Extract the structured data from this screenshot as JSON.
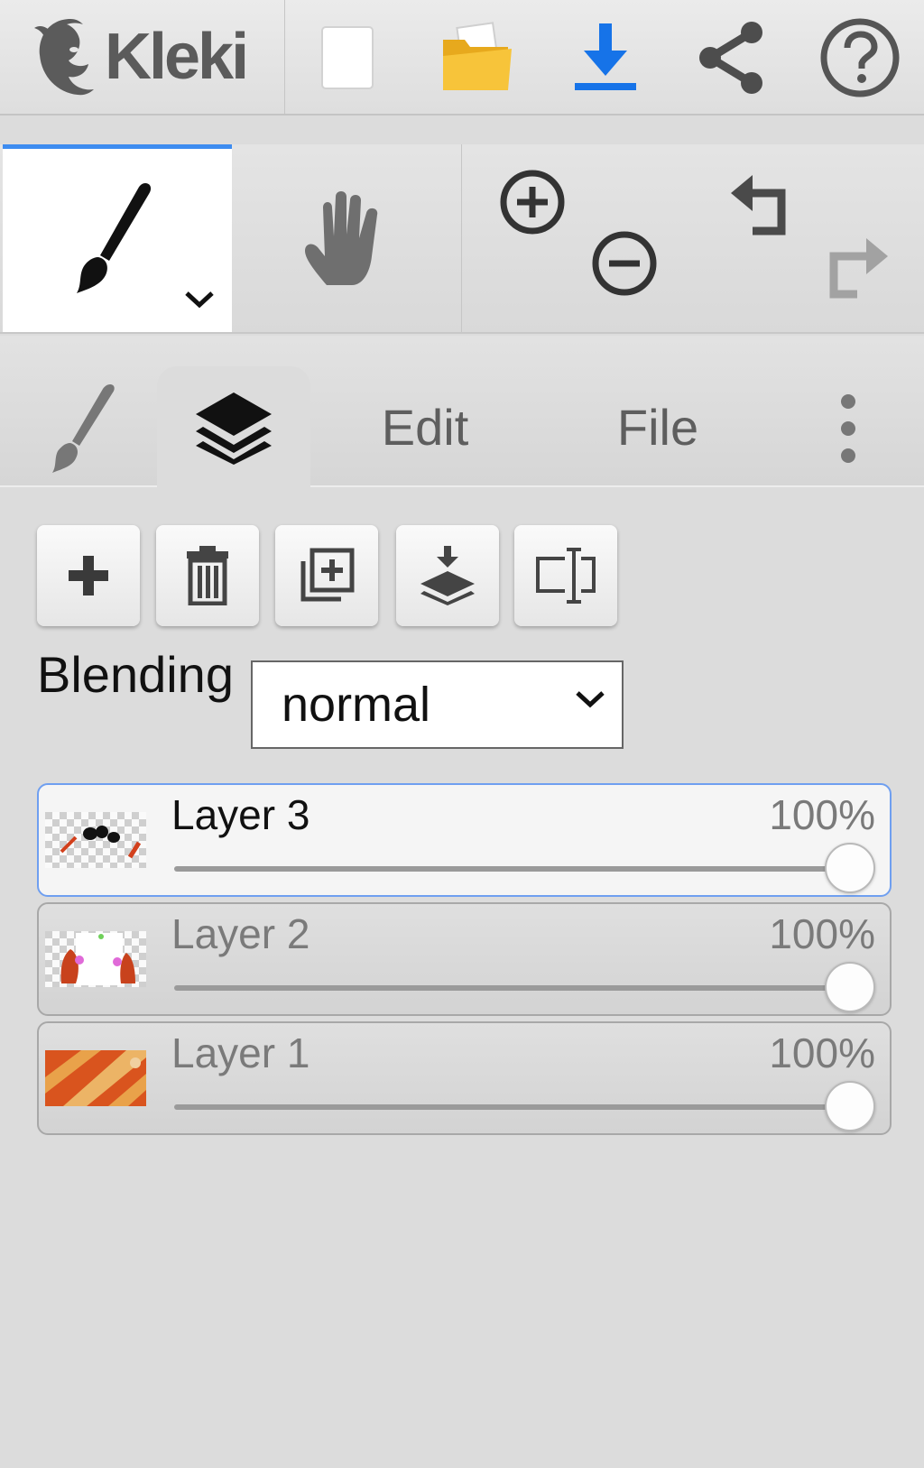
{
  "app": {
    "name": "Kleki"
  },
  "topbar": {
    "icons": [
      "new-image-icon",
      "open-folder-icon",
      "download-icon",
      "share-icon",
      "help-icon"
    ],
    "accent": "#1673e8"
  },
  "toolbar": {
    "active_tool": "brush",
    "icons": [
      "brush-icon",
      "hand-icon",
      "zoom-in-icon",
      "zoom-out-icon",
      "undo-icon",
      "redo-icon"
    ]
  },
  "tabs": [
    {
      "id": "brush",
      "icon": "brush-icon",
      "label": ""
    },
    {
      "id": "layers",
      "icon": "layers-icon",
      "label": "",
      "active": true
    },
    {
      "id": "edit",
      "label": "Edit"
    },
    {
      "id": "file",
      "label": "File"
    },
    {
      "id": "more",
      "icon": "more-vertical-icon",
      "label": ""
    }
  ],
  "layers_panel": {
    "buttons": [
      "add-layer-icon",
      "delete-layer-icon",
      "duplicate-layer-icon",
      "merge-down-icon",
      "rename-layer-icon"
    ],
    "blending": {
      "label": "Blending",
      "value": "normal"
    },
    "layers": [
      {
        "name": "Layer 3",
        "opacity_label": "100%",
        "opacity": 1.0,
        "active": true
      },
      {
        "name": "Layer 2",
        "opacity_label": "100%",
        "opacity": 1.0,
        "active": false
      },
      {
        "name": "Layer 1",
        "opacity_label": "100%",
        "opacity": 1.0,
        "active": false
      }
    ]
  },
  "colors": {
    "active_border": "#6f9ff0",
    "selected_tab_line": "#3d8cf0"
  }
}
